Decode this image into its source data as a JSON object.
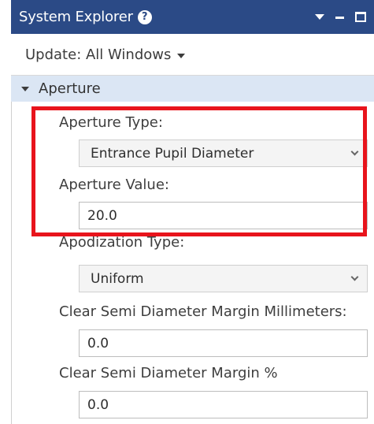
{
  "window": {
    "title": "System Explorer",
    "help_icon": "question-mark-circle-icon",
    "controls": [
      "dropdown-menu-icon",
      "minimize-icon",
      "maximize-icon"
    ]
  },
  "toolbar": {
    "update_label": "Update: All Windows"
  },
  "section": {
    "title": "Aperture",
    "expanded": true
  },
  "fields": {
    "aperture_type": {
      "label": "Aperture Type:",
      "value": "Entrance Pupil Diameter"
    },
    "aperture_value": {
      "label": "Aperture Value:",
      "value": "20.0"
    },
    "apodization_type": {
      "label": "Apodization Type:",
      "value": "Uniform"
    },
    "clear_semi_mm": {
      "label": "Clear Semi Diameter Margin Millimeters:",
      "value": "0.0"
    },
    "clear_semi_pct": {
      "label": "Clear Semi Diameter Margin %",
      "value": "0.0"
    }
  },
  "colors": {
    "titlebar": "#2b4a86",
    "section_header": "#dbe6f4",
    "highlight": "#e8141c"
  }
}
